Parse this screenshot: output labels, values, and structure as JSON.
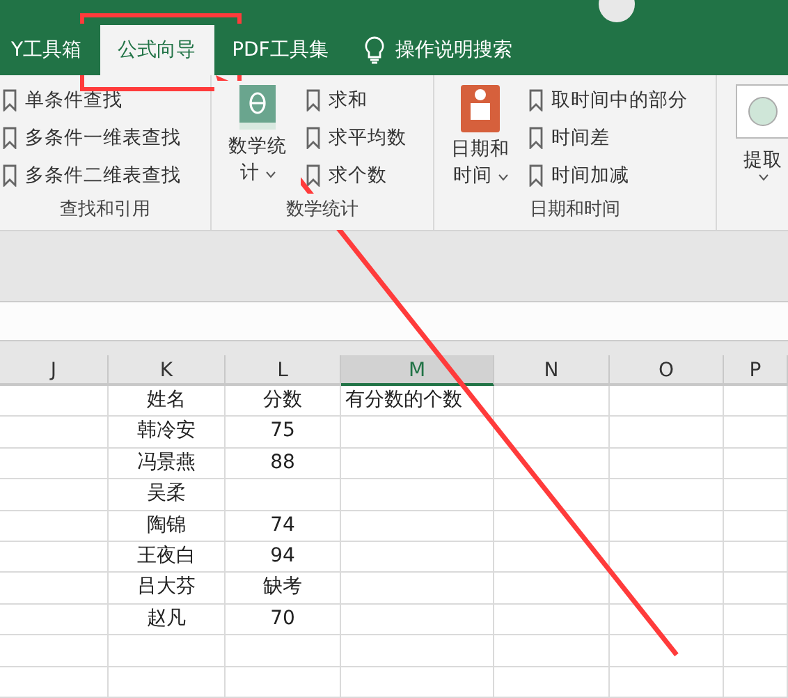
{
  "tabs": [
    {
      "label": "Y工具箱",
      "selected": false
    },
    {
      "label": "公式向导",
      "selected": true
    },
    {
      "label": "PDF工具集",
      "selected": false
    },
    {
      "label": "操作说明搜索",
      "selected": false,
      "kind": "search"
    }
  ],
  "ribbon": {
    "groups": [
      {
        "label": "查找和引用",
        "items": [
          "单条件查找",
          "多条件一维表查找",
          "多条件二维表查找"
        ]
      },
      {
        "label": "数学统计",
        "big": {
          "kind": "theta",
          "label": "数学统",
          "label2": "计"
        },
        "items": [
          "求和",
          "求平均数",
          "求个数"
        ]
      },
      {
        "label": "日期和时间",
        "big": {
          "kind": "calendar",
          "label": "日期和",
          "label2": "时间"
        },
        "items": [
          "取时间中的部分",
          "时间差",
          "时间加减"
        ]
      },
      {
        "big": {
          "kind": "circle",
          "label": "提取"
        }
      }
    ]
  },
  "sheet": {
    "columns": [
      {
        "label": "J",
        "selected": false
      },
      {
        "label": "K",
        "selected": false
      },
      {
        "label": "L",
        "selected": false
      },
      {
        "label": "M",
        "selected": true
      },
      {
        "label": "N",
        "selected": false
      },
      {
        "label": "O",
        "selected": false
      },
      {
        "label": "P",
        "selected": false
      }
    ],
    "rows": [
      {
        "k": "姓名",
        "l": "分数",
        "m": "有分数的个数"
      },
      {
        "k": "韩冷安",
        "l": "75"
      },
      {
        "k": "冯景燕",
        "l": "88"
      },
      {
        "k": "吴柔"
      },
      {
        "k": "陶锦",
        "l": "74"
      },
      {
        "k": "王夜白",
        "l": "94"
      },
      {
        "k": "吕大芬",
        "l": "缺考"
      },
      {
        "k": "赵凡",
        "l": "70"
      },
      {},
      {}
    ]
  }
}
